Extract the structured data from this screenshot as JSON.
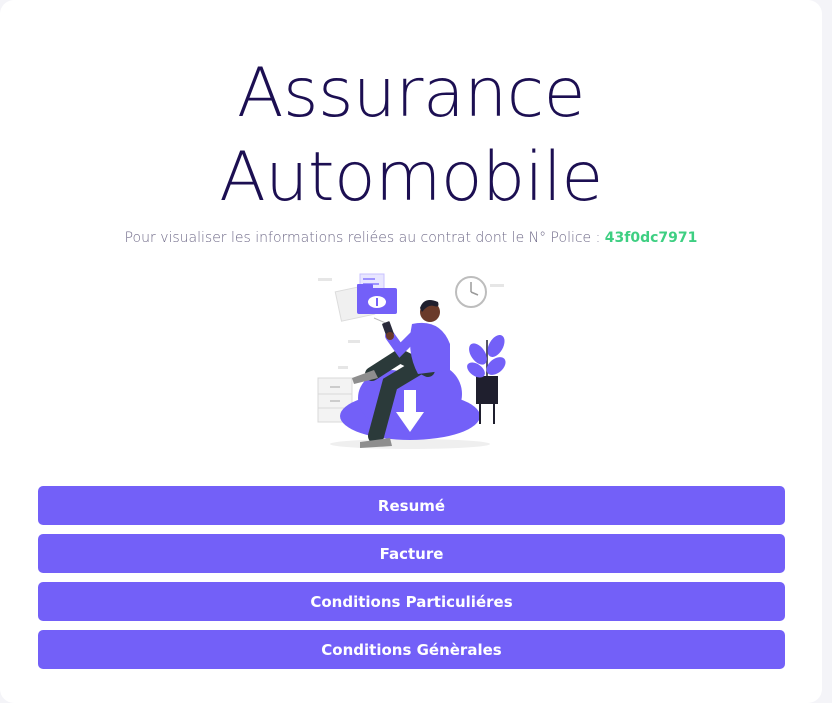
{
  "header": {
    "title_line1": "Assurance",
    "title_line2": "Automobile"
  },
  "subtitle": {
    "text": "Pour visualiser les informations reliées au contrat dont le N° Police : ",
    "policy_number": "43f0dc7971"
  },
  "illustration": {
    "icon": "person-cloud-download-illustration"
  },
  "buttons": [
    {
      "label": "Resumé"
    },
    {
      "label": "Facture"
    },
    {
      "label": "Conditions Particuliéres"
    },
    {
      "label": "Conditions Génèrales"
    }
  ],
  "colors": {
    "accent": "#7360f8",
    "title": "#1c0f52",
    "policy": "#3ecf82",
    "subtitle": "#6f6a88"
  }
}
